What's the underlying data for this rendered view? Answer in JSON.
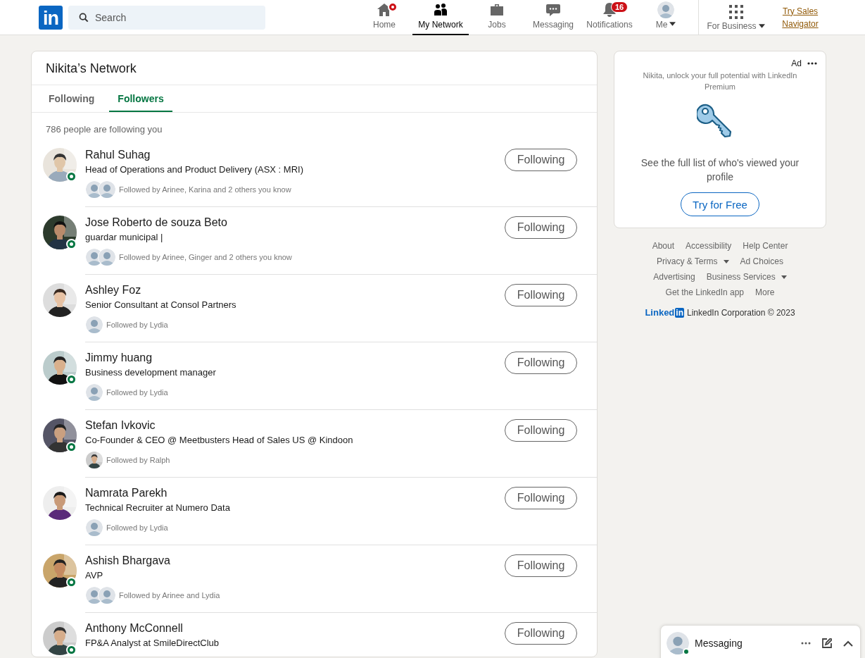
{
  "nav": {
    "logo": "in",
    "search": {
      "placeholder": "Search"
    },
    "items": [
      {
        "label": "Home",
        "kind": "home",
        "selected": false,
        "dot": true
      },
      {
        "label": "My Network",
        "kind": "network",
        "selected": true,
        "dot": false
      },
      {
        "label": "Jobs",
        "kind": "jobs",
        "selected": false,
        "dot": false
      },
      {
        "label": "Messaging",
        "kind": "messaging",
        "selected": false,
        "dot": false
      },
      {
        "label": "Notifications",
        "kind": "bell",
        "selected": false,
        "dot": false,
        "badge": "16"
      },
      {
        "label": "Me",
        "kind": "me",
        "selected": false,
        "dot": false
      }
    ],
    "business": "For Business",
    "promo": "Try Sales Navigator"
  },
  "network": {
    "title": "Nikita’s Network",
    "tabs": [
      {
        "label": "Following",
        "selected": false
      },
      {
        "label": "Followers",
        "selected": true
      }
    ],
    "summary": "786 people are following you",
    "people": [
      {
        "name": "Rahul Suhag",
        "headline": "Head of Operations and Product Delivery (ASX : MRI)",
        "followed_by": "Followed by Arinee, Karina and 2 others you know",
        "online": true,
        "mutuals": [
          {
            "kind": "silhouette"
          },
          {
            "kind": "silhouette"
          }
        ],
        "button": "Following"
      },
      {
        "name": "Jose Roberto de souza Beto",
        "headline": "guardar municipal |",
        "followed_by": "Followed by Arinee, Ginger and 2 others you know",
        "online": true,
        "mutuals": [
          {
            "kind": "silhouette"
          },
          {
            "kind": "silhouette"
          }
        ],
        "button": "Following"
      },
      {
        "name": "Ashley Foz",
        "headline": "Senior Consultant at Consol Partners",
        "followed_by": "Followed by Lydia",
        "online": false,
        "mutuals": [
          {
            "kind": "silhouette"
          }
        ],
        "button": "Following"
      },
      {
        "name": "Jimmy huang",
        "headline": "Business development manager",
        "followed_by": "Followed by Lydia",
        "online": true,
        "mutuals": [
          {
            "kind": "silhouette"
          }
        ],
        "button": "Following"
      },
      {
        "name": "Stefan Ivkovic",
        "headline": "Co-Founder & CEO @ Meetbusters Head of Sales US @ Kindoon",
        "followed_by": "Followed by Ralph",
        "online": true,
        "button": "Following"
      },
      {
        "name": "Namrata Parekh",
        "headline": "Technical Recruiter at Numero Data",
        "followed_by": "Followed by Lydia",
        "online": false,
        "mutuals": [
          {
            "kind": "silhouette"
          }
        ],
        "button": "Following"
      },
      {
        "name": "Ashish Bhargava",
        "headline": "AVP",
        "followed_by": "Followed by Arinee and Lydia",
        "online": true,
        "mutuals": [
          {
            "kind": "silhouette"
          },
          {
            "kind": "silhouette"
          }
        ],
        "button": "Following"
      },
      {
        "name": "Anthony McConnell",
        "headline": "FP&A Analyst at SmileDirectClub",
        "online": true,
        "button": "Following"
      }
    ]
  },
  "ad": {
    "label": "Ad",
    "tagline": "Nikita, unlock your full potential with LinkedIn Premium",
    "message": "See the full list of who's viewed your profile",
    "cta": "Try for Free"
  },
  "footer": {
    "link_rows": [
      [
        {
          "label": "About",
          "caret": false
        },
        {
          "label": "Accessibility",
          "caret": false
        },
        {
          "label": "Help Center",
          "caret": false
        }
      ],
      [
        {
          "label": "Privacy & Terms",
          "caret": true
        },
        {
          "label": "Ad Choices",
          "caret": false
        }
      ],
      [
        {
          "label": "Advertising",
          "caret": false
        },
        {
          "label": "Business Services",
          "caret": true
        }
      ],
      [
        {
          "label": "Get the LinkedIn app",
          "caret": false
        },
        {
          "label": "More",
          "caret": false
        }
      ]
    ],
    "brand": {
      "word": "Linked",
      "mark": "in"
    },
    "copyright": "LinkedIn Corporation © 2023"
  },
  "messaging": {
    "title": "Messaging",
    "online": true
  }
}
